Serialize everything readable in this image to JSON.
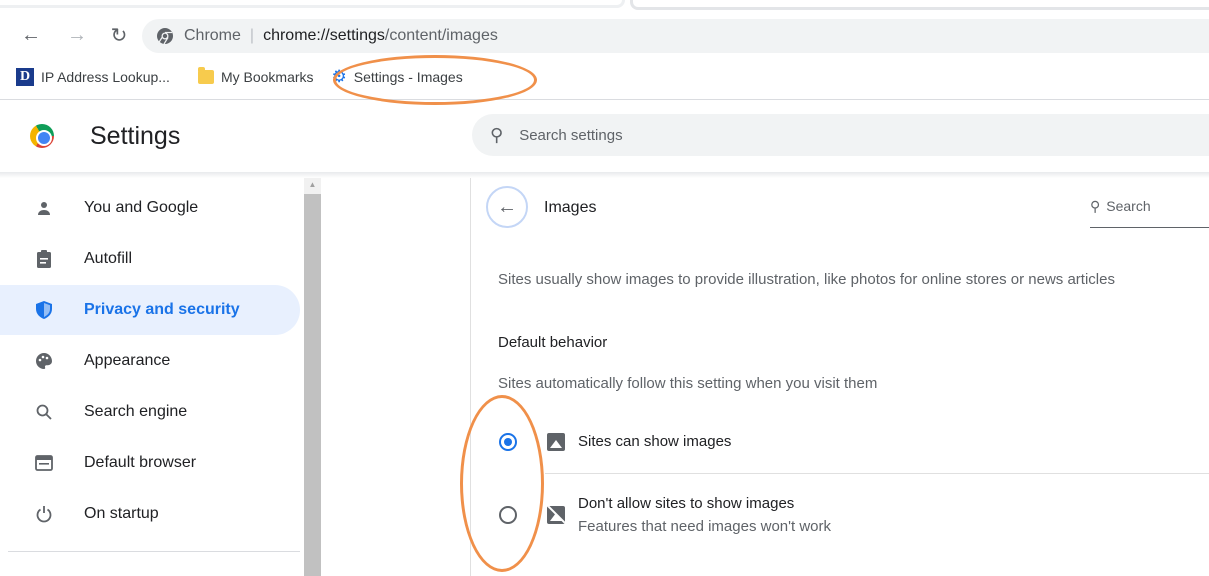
{
  "browser": {
    "omnibox": {
      "site_label": "Chrome",
      "separator": "|",
      "url_host": "chrome://settings",
      "url_path": "/content/images"
    },
    "bookmarks": [
      {
        "label": "IP Address Lookup...",
        "icon": "d-favicon-icon"
      },
      {
        "label": "My Bookmarks",
        "icon": "folder-icon"
      },
      {
        "label": "Settings - Images",
        "icon": "gear-icon"
      }
    ]
  },
  "settings": {
    "title": "Settings",
    "search_placeholder": "Search settings"
  },
  "sidebar": {
    "items": [
      {
        "label": "You and Google",
        "icon": "person-icon"
      },
      {
        "label": "Autofill",
        "icon": "clipboard-icon"
      },
      {
        "label": "Privacy and security",
        "icon": "shield-icon",
        "active": true
      },
      {
        "label": "Appearance",
        "icon": "palette-icon"
      },
      {
        "label": "Search engine",
        "icon": "search-icon"
      },
      {
        "label": "Default browser",
        "icon": "browser-icon"
      },
      {
        "label": "On startup",
        "icon": "power-icon"
      }
    ]
  },
  "main": {
    "heading": "Images",
    "search_label": "Search",
    "description": "Sites usually show images to provide illustration, like photos for online stores or news articles",
    "default_behavior": {
      "title": "Default behavior",
      "subtitle": "Sites automatically follow this setting when you visit them",
      "options": [
        {
          "label": "Sites can show images",
          "sublabel": "",
          "selected": true,
          "icon": "image-icon"
        },
        {
          "label": "Don't allow sites to show images",
          "sublabel": "Features that need images won't work",
          "selected": false,
          "icon": "image-blocked-icon"
        }
      ]
    }
  },
  "colors": {
    "accent": "#1a73e8",
    "annotation": "#f0904a",
    "active_bg": "#e8f0fe"
  }
}
